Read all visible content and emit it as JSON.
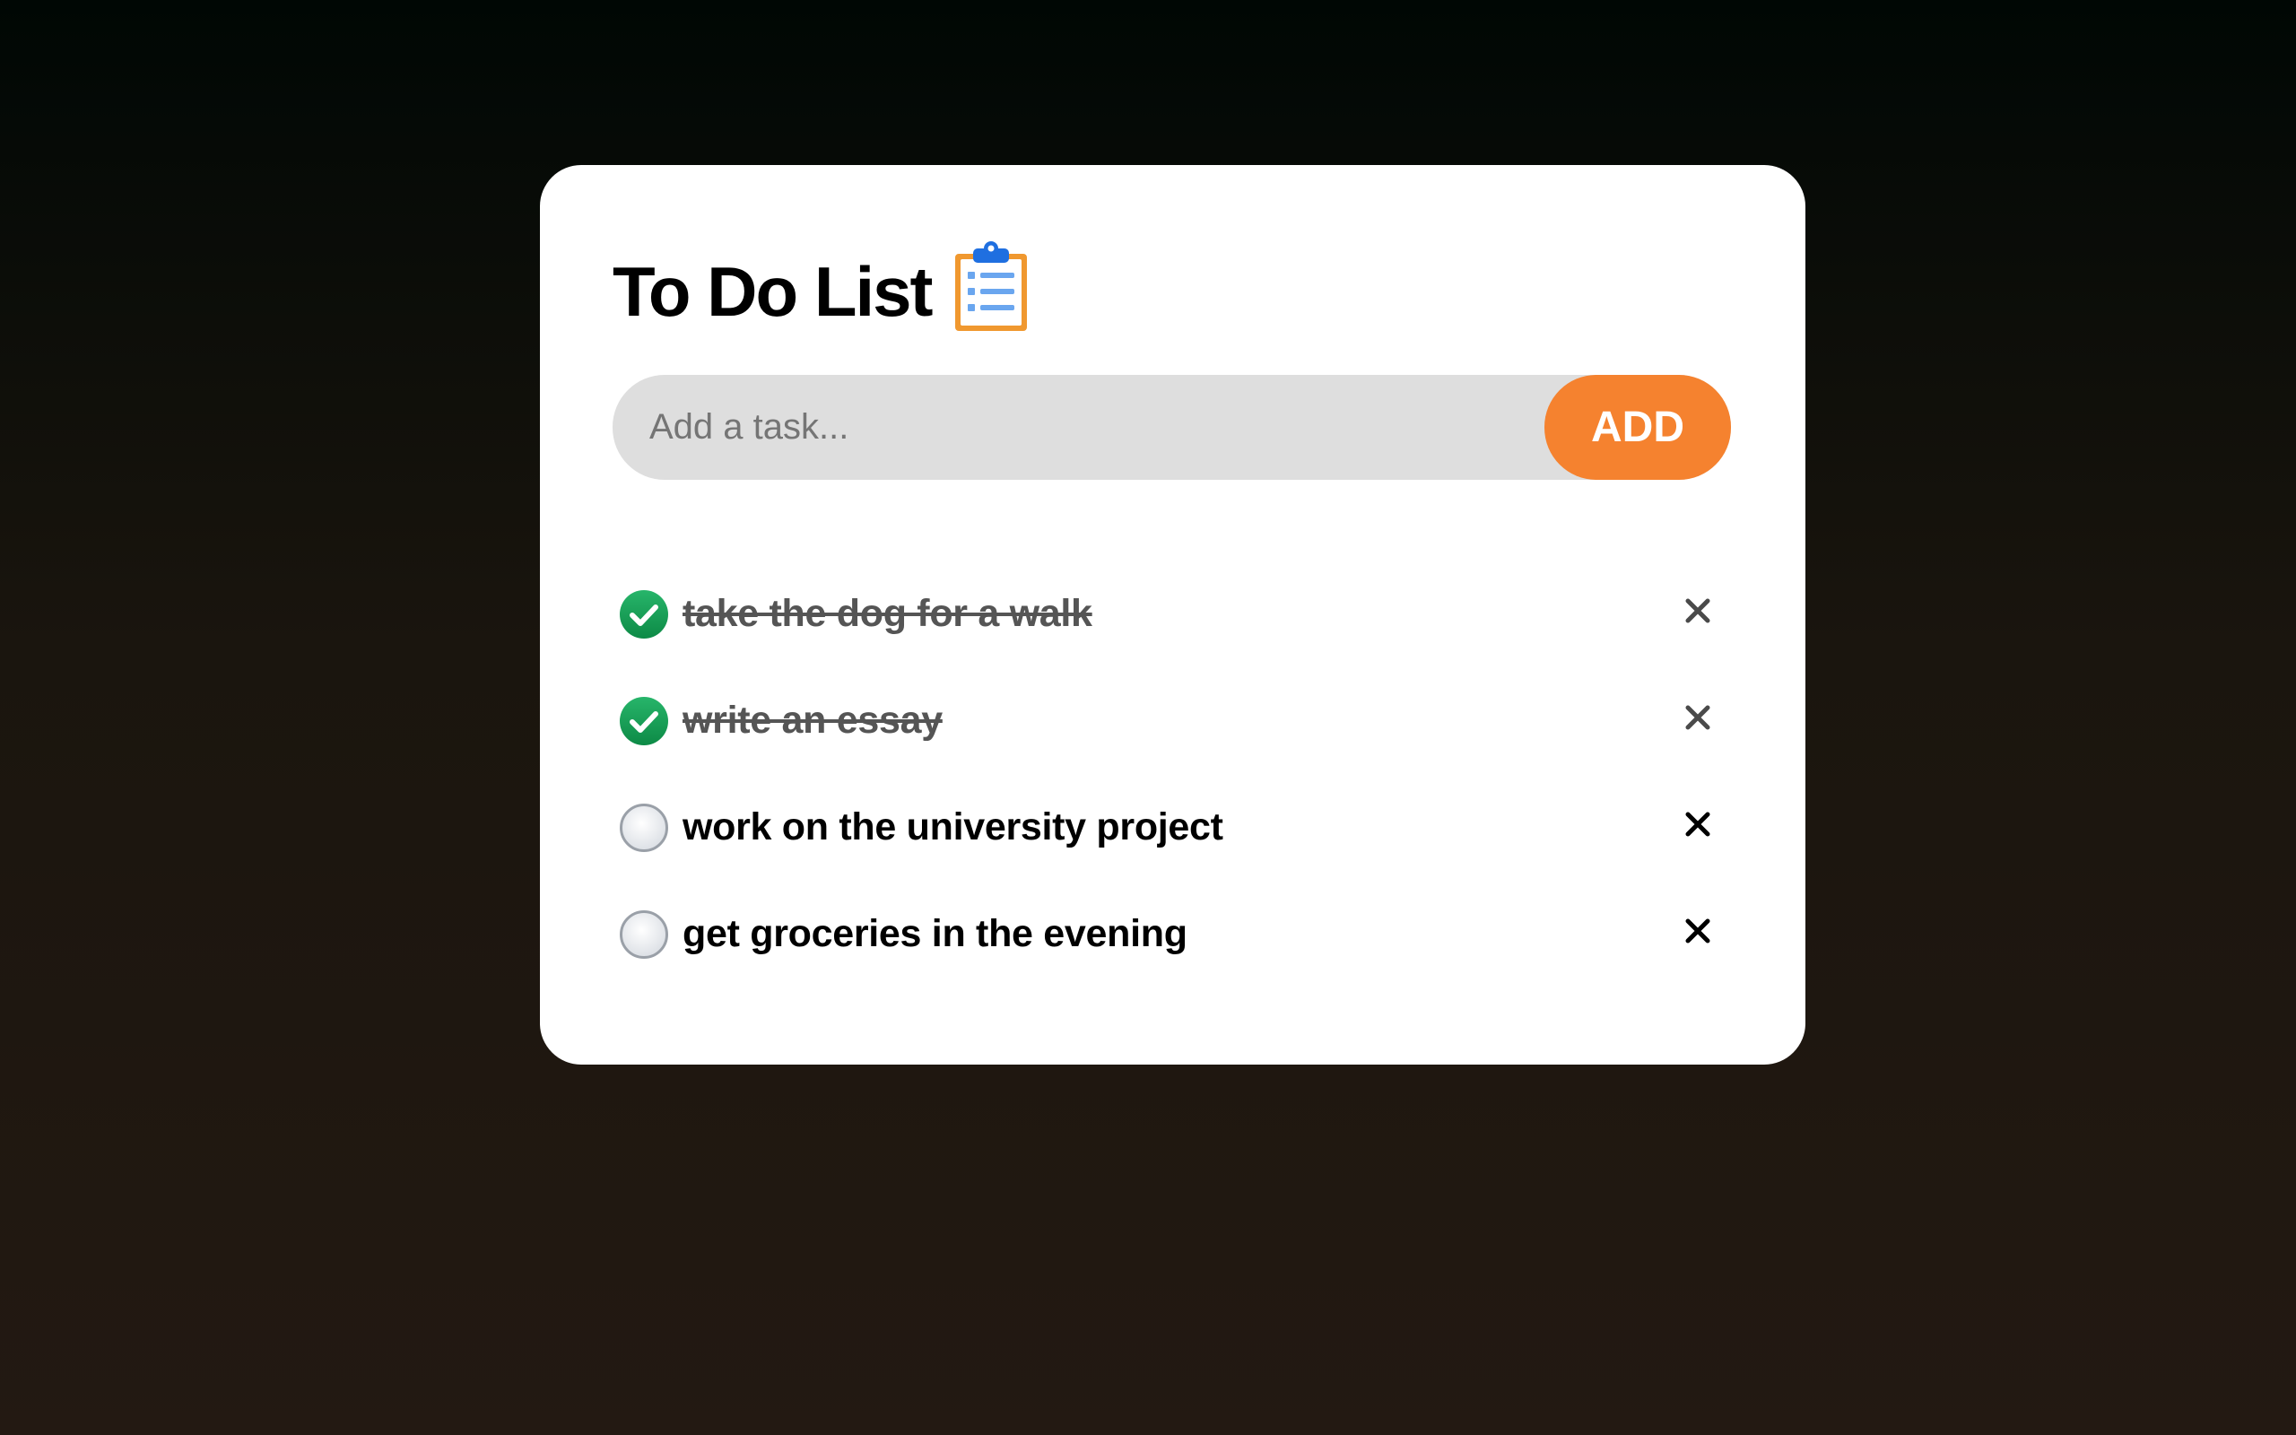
{
  "app": {
    "title": "To Do List",
    "title_icon": "clipboard-list-icon"
  },
  "input": {
    "placeholder": "Add a task...",
    "value": "",
    "add_label": "ADD"
  },
  "colors": {
    "accent": "#f5822f",
    "done_check": "#1aa159",
    "done_text": "#555555"
  },
  "tasks": [
    {
      "text": "take the dog for a walk",
      "done": true,
      "delete_icon": "close-icon"
    },
    {
      "text": "write an essay",
      "done": true,
      "delete_icon": "close-icon"
    },
    {
      "text": "work on the university project",
      "done": false,
      "delete_icon": "close-icon"
    },
    {
      "text": "get groceries in the evening",
      "done": false,
      "delete_icon": "close-icon"
    }
  ]
}
